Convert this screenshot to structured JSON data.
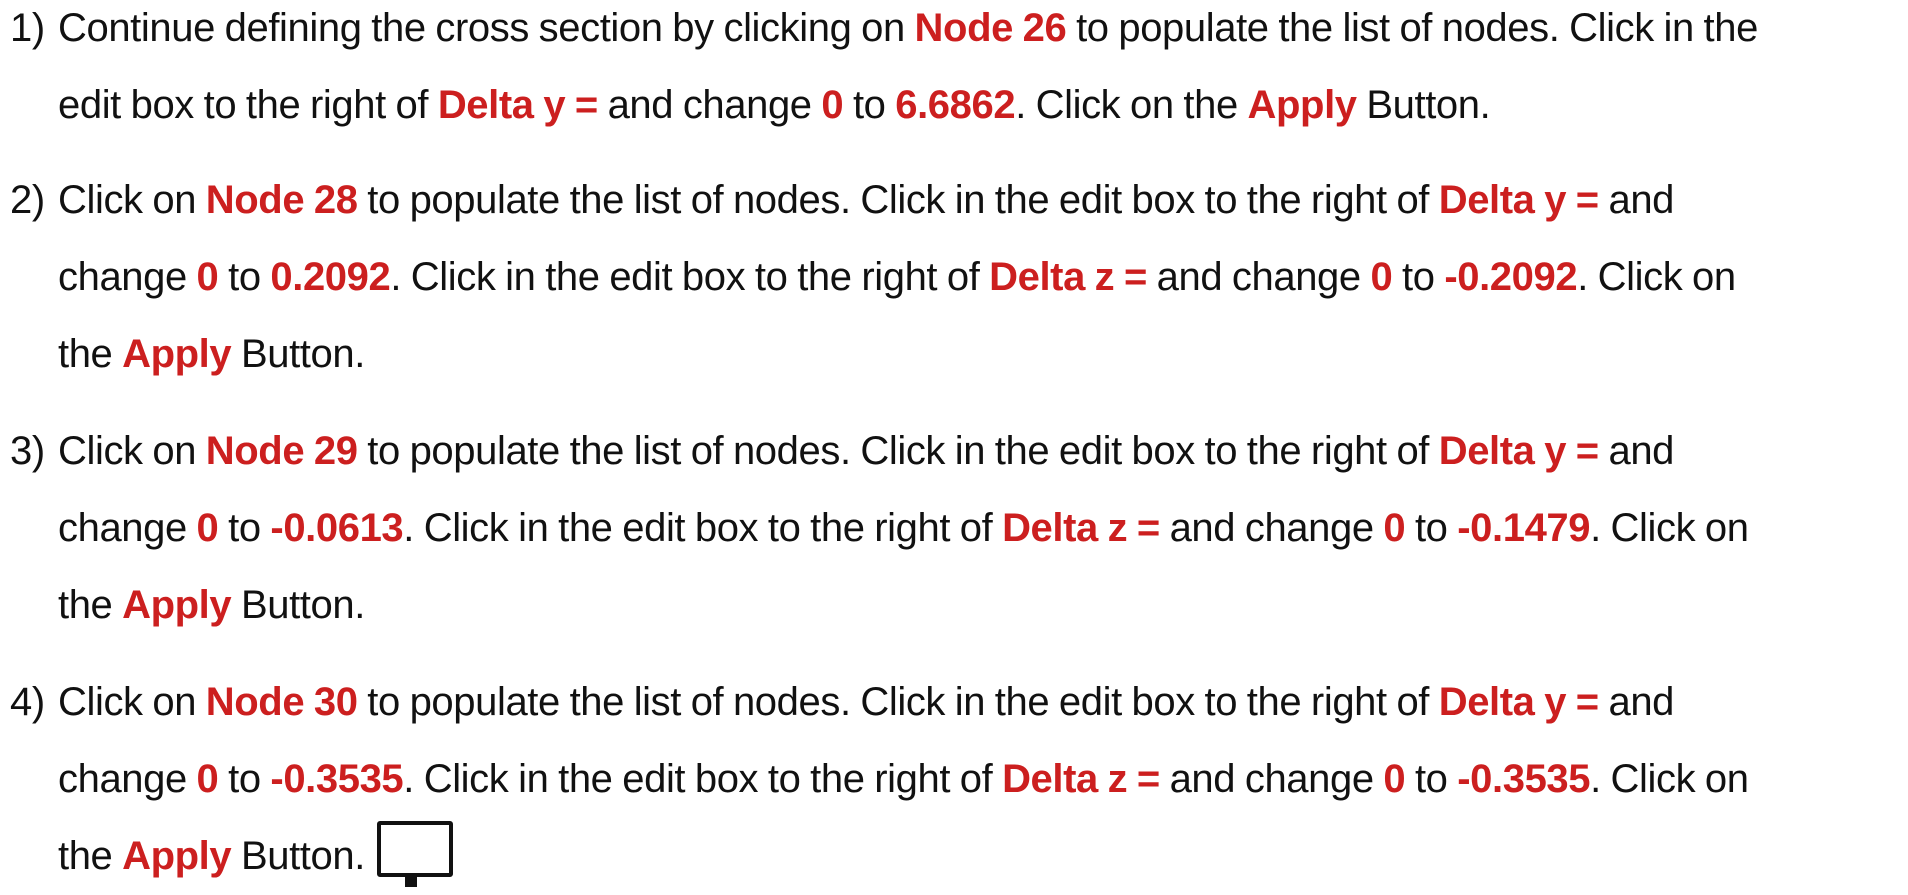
{
  "steps": [
    {
      "number": "1)",
      "lines": [
        [
          {
            "t": "Continue defining the cross section by clicking on "
          },
          {
            "t": "Node 26",
            "h": true
          },
          {
            "t": " to populate the list of nodes. Click in the"
          }
        ],
        [
          {
            "t": "edit box to the right of "
          },
          {
            "t": "Delta y =",
            "h": true
          },
          {
            "t": " and change "
          },
          {
            "t": "0",
            "h": true
          },
          {
            "t": " to "
          },
          {
            "t": "6.6862",
            "h": true
          },
          {
            "t": ". Click on the "
          },
          {
            "t": "Apply",
            "h": true
          },
          {
            "t": " Button."
          }
        ]
      ]
    },
    {
      "number": "2)",
      "lines": [
        [
          {
            "t": "Click on "
          },
          {
            "t": "Node 28",
            "h": true
          },
          {
            "t": " to populate the list of nodes. Click in the edit box to the right of "
          },
          {
            "t": "Delta y =",
            "h": true
          },
          {
            "t": " and"
          }
        ],
        [
          {
            "t": "change "
          },
          {
            "t": "0",
            "h": true
          },
          {
            "t": " to "
          },
          {
            "t": "0.2092",
            "h": true
          },
          {
            "t": ". Click in the edit box to the right of "
          },
          {
            "t": "Delta z =",
            "h": true
          },
          {
            "t": " and change "
          },
          {
            "t": "0",
            "h": true
          },
          {
            "t": " to "
          },
          {
            "t": "-0.2092",
            "h": true
          },
          {
            "t": ". Click on"
          }
        ],
        [
          {
            "t": "the "
          },
          {
            "t": "Apply",
            "h": true
          },
          {
            "t": " Button."
          }
        ]
      ]
    },
    {
      "number": "3)",
      "lines": [
        [
          {
            "t": "Click on "
          },
          {
            "t": "Node 29",
            "h": true
          },
          {
            "t": " to populate the list of nodes. Click in the edit box to the right of "
          },
          {
            "t": "Delta y =",
            "h": true
          },
          {
            "t": " and"
          }
        ],
        [
          {
            "t": "change "
          },
          {
            "t": "0",
            "h": true
          },
          {
            "t": " to "
          },
          {
            "t": "-0.0613",
            "h": true
          },
          {
            "t": ". Click in the edit box to the right of "
          },
          {
            "t": "Delta z =",
            "h": true
          },
          {
            "t": " and change "
          },
          {
            "t": "0",
            "h": true
          },
          {
            "t": " to "
          },
          {
            "t": "-0.1479",
            "h": true
          },
          {
            "t": ". Click on"
          }
        ],
        [
          {
            "t": "the "
          },
          {
            "t": "Apply",
            "h": true
          },
          {
            "t": " Button."
          }
        ]
      ]
    },
    {
      "number": "4)",
      "lines": [
        [
          {
            "t": "Click on "
          },
          {
            "t": "Node 30",
            "h": true
          },
          {
            "t": " to populate the list of nodes. Click in the edit box to the right of "
          },
          {
            "t": "Delta y =",
            "h": true
          },
          {
            "t": " and"
          }
        ],
        [
          {
            "t": "change "
          },
          {
            "t": "0",
            "h": true
          },
          {
            "t": " to "
          },
          {
            "t": "-0.3535",
            "h": true
          },
          {
            "t": ". Click in the edit box to the right of "
          },
          {
            "t": "Delta z =",
            "h": true
          },
          {
            "t": " and change "
          },
          {
            "t": "0",
            "h": true
          },
          {
            "t": " to "
          },
          {
            "t": "-0.3535",
            "h": true
          },
          {
            "t": ". Click on"
          }
        ],
        [
          {
            "t": "the "
          },
          {
            "t": "Apply",
            "h": true
          },
          {
            "t": " Button."
          }
        ]
      ],
      "end_icon": "monitor-icon"
    }
  ],
  "colors": {
    "highlight": "#cc1f1f",
    "text": "#111111",
    "background": "#ffffff"
  }
}
